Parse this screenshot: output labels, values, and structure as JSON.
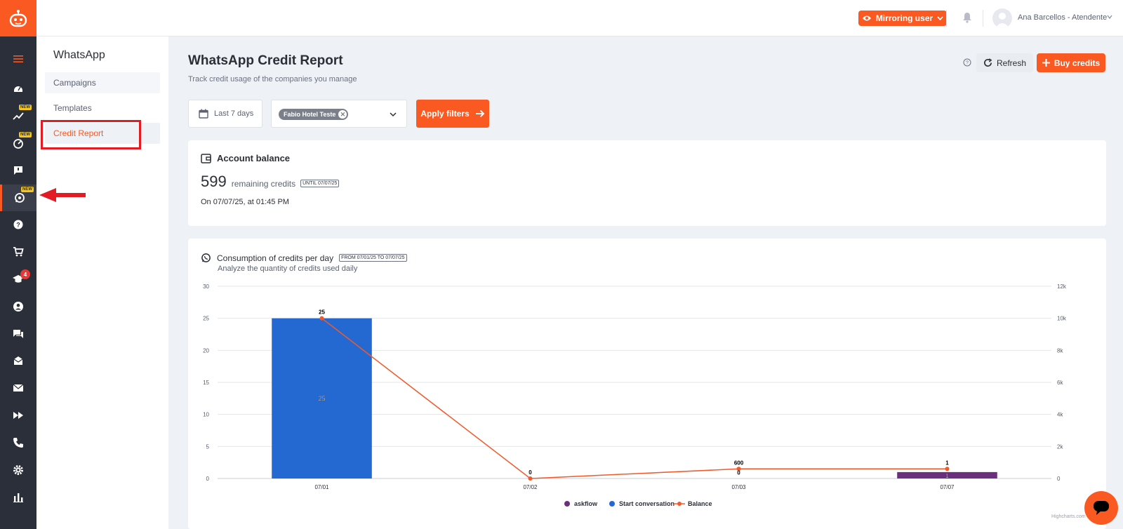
{
  "header": {
    "mirror_label": "Mirroring user",
    "user_name": "Ana Barcellos - Atendente"
  },
  "rail": {
    "new_tag": "NEW",
    "notifications_count": "4",
    "icons": [
      "menu-icon",
      "dashboard-icon",
      "trend-icon",
      "speed-icon",
      "feedback-icon",
      "whatsapp-icon",
      "help-icon",
      "cart-icon",
      "school-icon",
      "account-icon",
      "chat-icon",
      "inbox-icon",
      "mail-icon",
      "forward-icon",
      "phone-icon",
      "settings-icon",
      "bar-chart-icon"
    ]
  },
  "submenu": {
    "title": "WhatsApp",
    "items": [
      {
        "label": "Campaigns"
      },
      {
        "label": "Templates"
      },
      {
        "label": "Credit Report"
      }
    ]
  },
  "page": {
    "title": "WhatsApp Credit Report",
    "subtitle": "Track credit usage of the companies you manage",
    "refresh_label": "Refresh",
    "buy_label": "Buy credits"
  },
  "filters": {
    "date_range": "Last 7 days",
    "company_chip": "Fabio Hotel Teste",
    "apply_label": "Apply filters"
  },
  "balance": {
    "title": "Account balance",
    "credits": "599",
    "credits_label": "remaining credits",
    "until_tag": "UNTIL 07/07/25",
    "as_of": "On 07/07/25, at 01:45 PM"
  },
  "consumption": {
    "title": "Consumption of credits per day",
    "range_tag": "FROM 07/01/25 TO 07/07/25",
    "subtitle": "Analyze the quantity of credits used daily"
  },
  "chart_credit": "Highcharts.com",
  "colors": {
    "accent": "#fa5a22",
    "start_conversation": "#2469d2",
    "askflow": "#6a2f7d",
    "balance_line": "#f25a2a"
  },
  "chart_data": {
    "type": "bar",
    "categories": [
      "07/01",
      "07/02",
      "07/03",
      "07/07"
    ],
    "series": [
      {
        "name": "askflow",
        "type": "bar",
        "axis": "left",
        "values": [
          0,
          0,
          0,
          1
        ],
        "labels": [
          "",
          "",
          "0",
          "1"
        ]
      },
      {
        "name": "Start conversation",
        "type": "bar",
        "axis": "left",
        "values": [
          25,
          0,
          0,
          0
        ],
        "labels": [
          "25",
          "",
          "",
          ""
        ]
      },
      {
        "name": "Balance",
        "type": "line",
        "axis": "right",
        "values": [
          10000,
          0,
          600,
          600
        ],
        "labels": [
          "25",
          "0",
          "600",
          "1"
        ]
      }
    ],
    "left_axis": {
      "range": [
        0,
        30
      ],
      "ticks": [
        "0",
        "5",
        "10",
        "15",
        "20",
        "25",
        "30"
      ]
    },
    "right_axis": {
      "range": [
        0,
        12000
      ],
      "ticks": [
        "0",
        "2k",
        "4k",
        "6k",
        "8k",
        "10k",
        "12k"
      ]
    },
    "grid": true,
    "legend": "bottom-center"
  }
}
